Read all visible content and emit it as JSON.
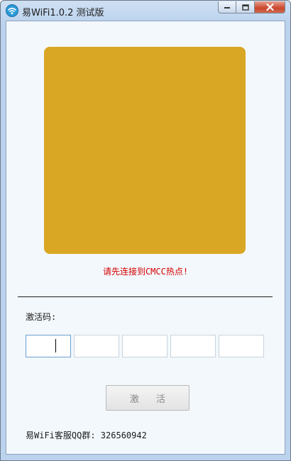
{
  "window": {
    "title": "易WiFi1.0.2 测试版"
  },
  "hint": "请先连接到CMCC热点!",
  "activation": {
    "label": "激活码:",
    "fields": [
      "",
      "",
      "",
      "",
      ""
    ],
    "button_label": "激 活"
  },
  "support": "易WiFi客服QQ群: 326560942",
  "colors": {
    "qr_placeholder": "#d9a723",
    "hint": "#d40000"
  }
}
